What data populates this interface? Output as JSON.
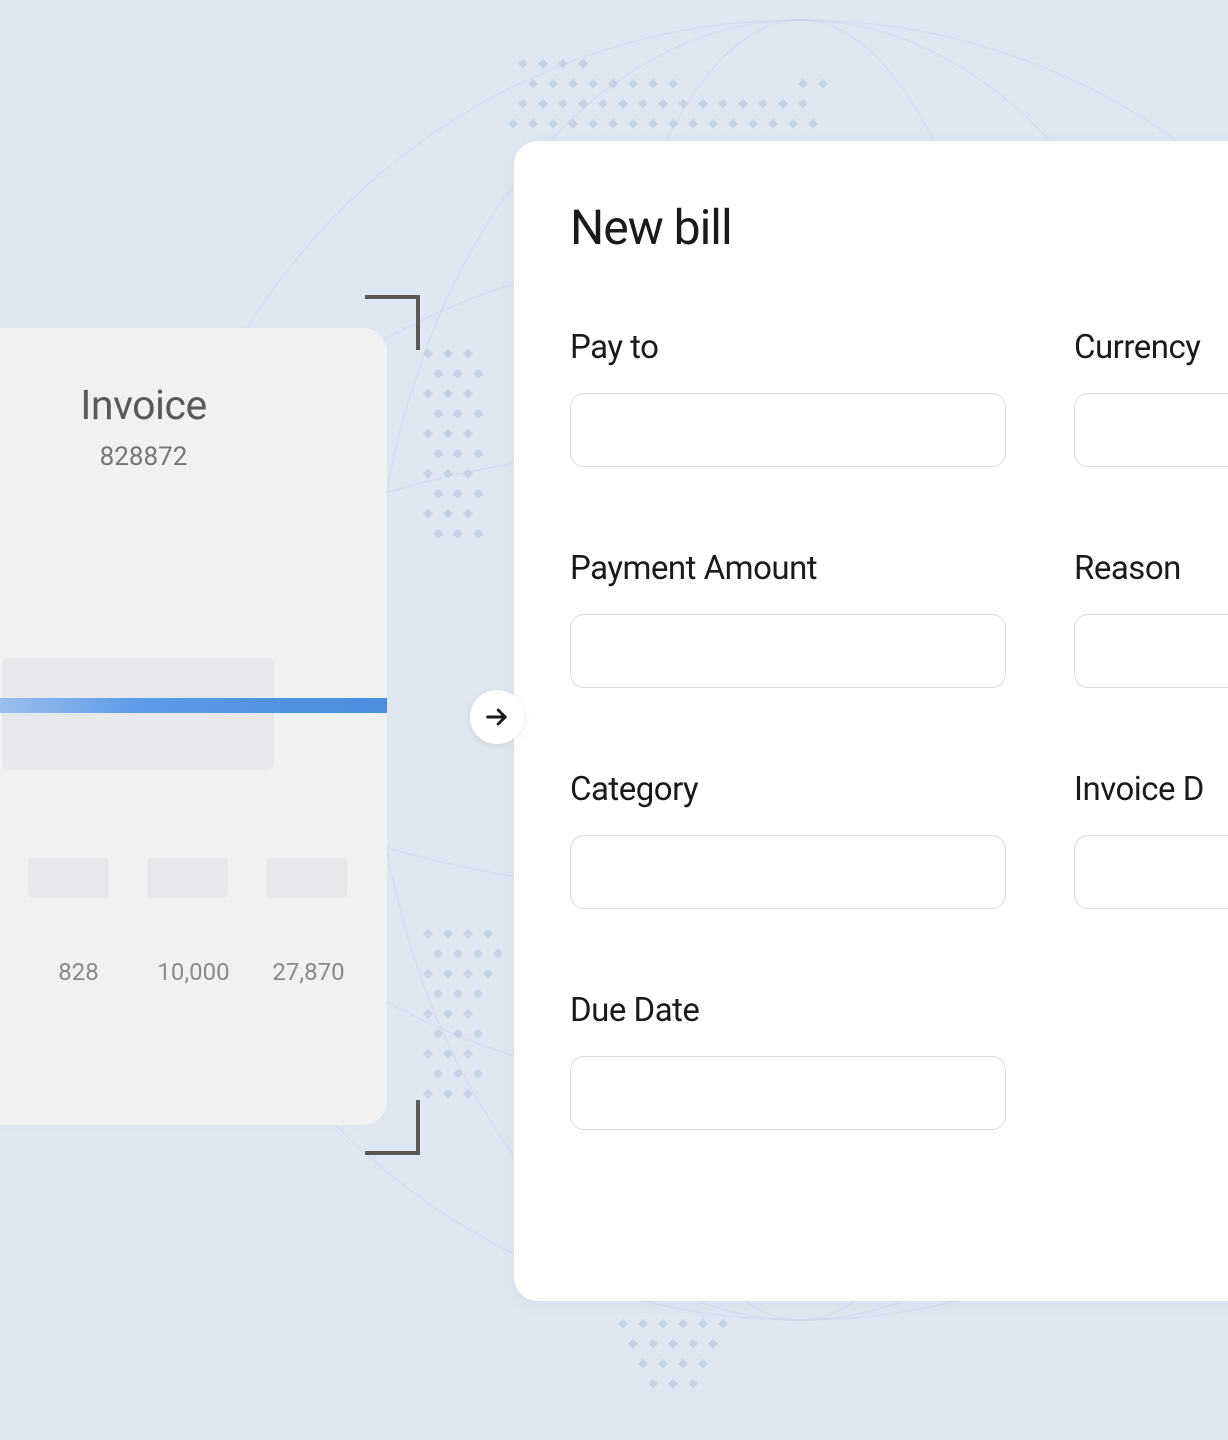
{
  "invoice": {
    "title": "Invoice",
    "number": "828872",
    "values": [
      "828",
      "10,000",
      "27,870"
    ]
  },
  "bill": {
    "title": "New bill",
    "fields": {
      "pay_to": {
        "label": "Pay to",
        "value": ""
      },
      "currency": {
        "label": "Currency",
        "value": ""
      },
      "payment_amount": {
        "label": "Payment Amount",
        "value": ""
      },
      "reason": {
        "label": "Reason",
        "value": ""
      },
      "category": {
        "label": "Category",
        "value": ""
      },
      "invoice_date": {
        "label": "Invoice D",
        "value": ""
      },
      "due_date": {
        "label": "Due Date",
        "value": ""
      }
    }
  }
}
